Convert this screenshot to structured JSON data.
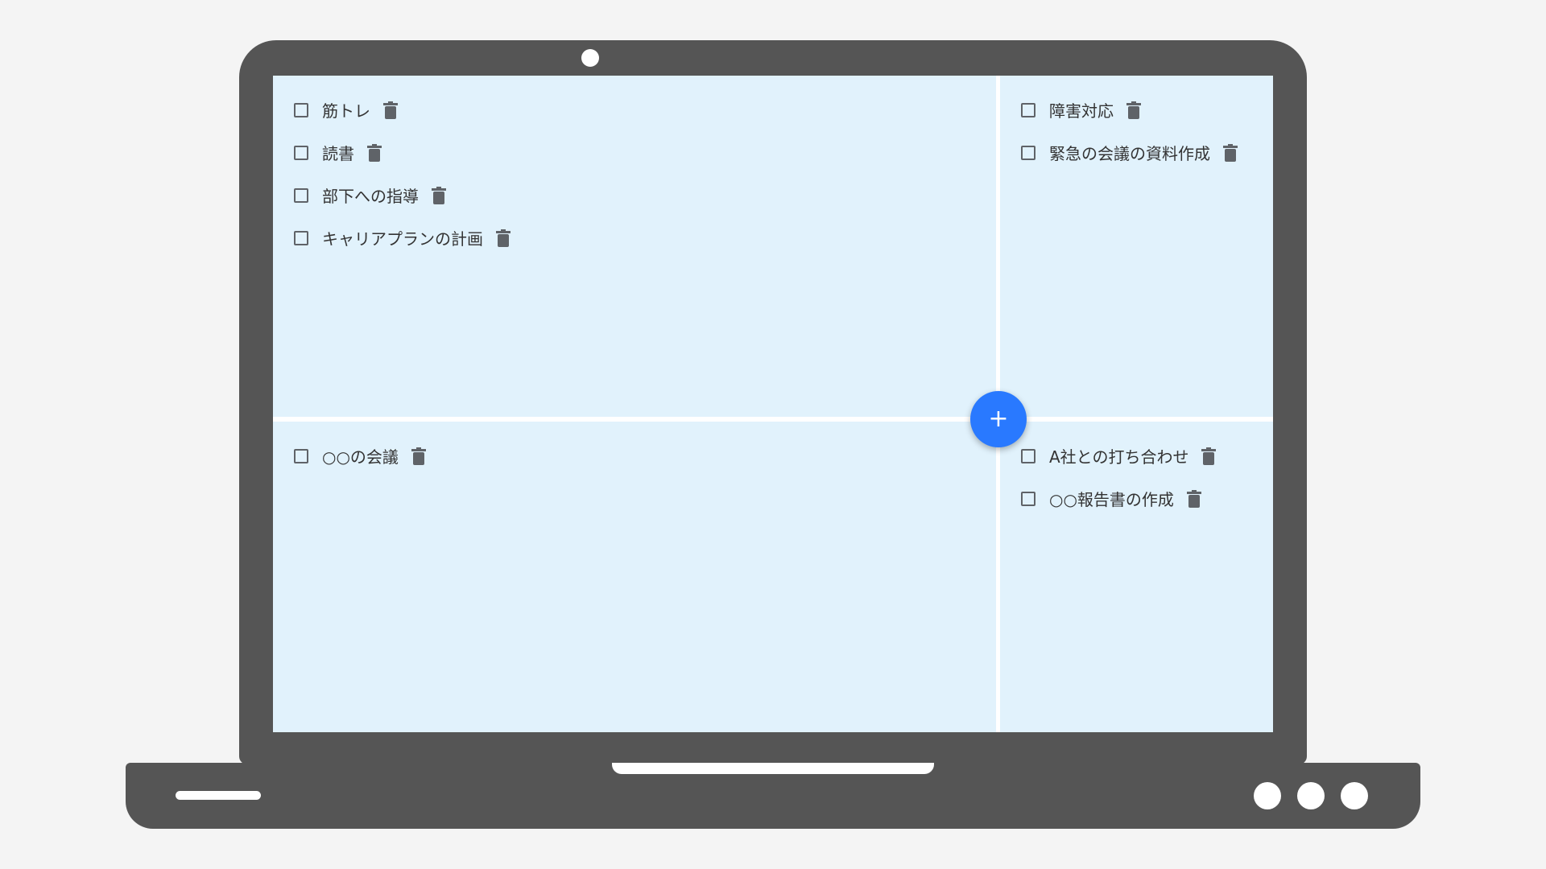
{
  "quadrants": {
    "top_left": {
      "tasks": [
        {
          "label": "筋トレ",
          "checked": false
        },
        {
          "label": "読書",
          "checked": false
        },
        {
          "label": "部下への指導",
          "checked": false
        },
        {
          "label": "キャリアプランの計画",
          "checked": false
        }
      ]
    },
    "top_right": {
      "tasks": [
        {
          "label": "障害対応",
          "checked": false
        },
        {
          "label": "緊急の会議の資料作成",
          "checked": false
        }
      ]
    },
    "bottom_left": {
      "tasks": [
        {
          "label": "○○の会議",
          "checked": false
        }
      ]
    },
    "bottom_right": {
      "tasks": [
        {
          "label": "A社との打ち合わせ",
          "checked": false
        },
        {
          "label": "○○報告書の作成",
          "checked": false
        }
      ]
    }
  },
  "fab": {
    "label": "+",
    "color": "#2979ff"
  },
  "icons": {
    "delete": "trash-icon",
    "add": "plus-icon"
  },
  "colors": {
    "quadrant_bg": "#e1f2fc",
    "device": "#555555",
    "page_bg": "#f4f4f4",
    "icon": "#5f6368"
  }
}
